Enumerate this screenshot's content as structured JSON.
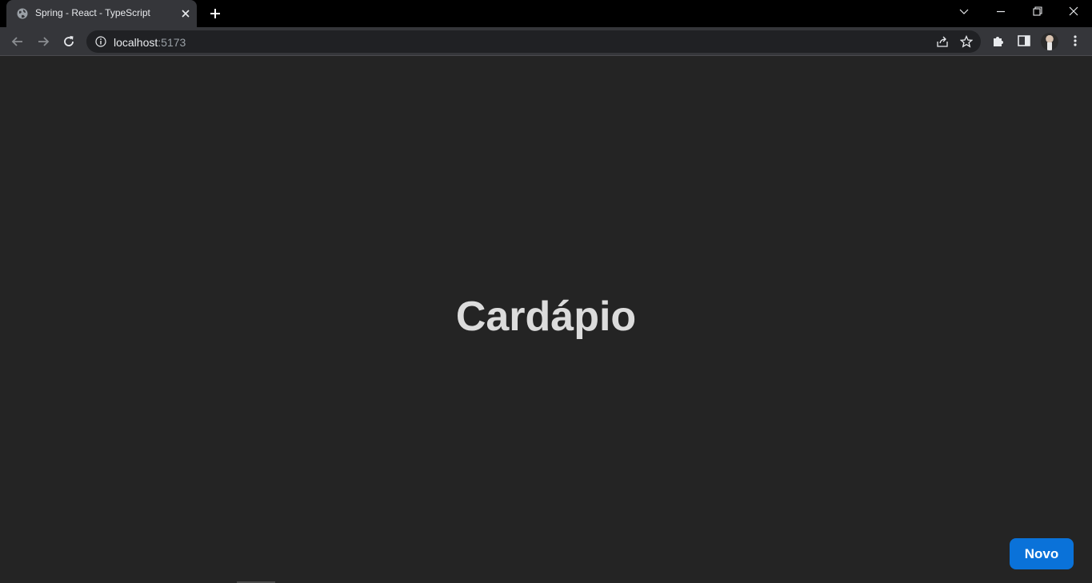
{
  "browser": {
    "tab": {
      "title": "Spring - React - TypeScript",
      "favicon": "globe-icon"
    },
    "address": {
      "host": "localhost",
      "port": ":5173"
    }
  },
  "page": {
    "title": "Cardápio",
    "new_button_label": "Novo"
  },
  "colors": {
    "page_background": "#242424",
    "title_text": "#dcdcdc",
    "button_background": "#0a72d9",
    "button_text": "#ffffff"
  }
}
